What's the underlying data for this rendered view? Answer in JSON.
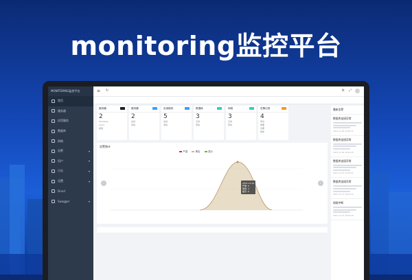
{
  "banner": {
    "title": "monitoring监控平台"
  },
  "app": {
    "brand": "MONITORING监控平台",
    "nav": [
      {
        "label": "首页",
        "arrow": ""
      },
      {
        "label": "服务器",
        "arrow": ""
      },
      {
        "label": "应用服务",
        "arrow": ""
      },
      {
        "label": "数据库",
        "arrow": ""
      },
      {
        "label": "网络",
        "arrow": ""
      },
      {
        "label": "告警",
        "arrow": "▾"
      },
      {
        "label": "用户",
        "arrow": "▾"
      },
      {
        "label": "日志",
        "arrow": "▾"
      },
      {
        "label": "设置",
        "arrow": "▾"
      },
      {
        "label": "Druid",
        "arrow": ""
      },
      {
        "label": "Swagger",
        "arrow": "▾"
      }
    ],
    "cards": [
      {
        "title": "服务器",
        "tag_color": "#1f1f1f",
        "num": "2",
        "lines": [
          "Windows",
          "Linux",
          "其他"
        ]
      },
      {
        "title": "服务器",
        "tag_color": "#3aa1ff",
        "num": "2",
        "lines": [
          "在线",
          "离线"
        ]
      },
      {
        "title": "应用程序",
        "tag_color": "#3aa1ff",
        "num": "5",
        "lines": [
          "在线",
          "离线"
        ]
      },
      {
        "title": "数据库",
        "tag_color": "#36cbcb",
        "num": "3",
        "lines": [
          "正常",
          "离线"
        ]
      },
      {
        "title": "网络",
        "tag_color": "#36cbcb",
        "num": "3",
        "lines": [
          "正常",
          "离线"
        ]
      },
      {
        "title": "告警记录",
        "tag_color": "#f59a23",
        "num": "4",
        "lines": [
          "紧急",
          "重要",
          "次要",
          "警告"
        ]
      }
    ],
    "chart": {
      "title": "告警统计",
      "legend": [
        {
          "name": "严重",
          "color": "#f5222d"
        },
        {
          "name": "警告",
          "color": "#d4b483"
        },
        {
          "name": "提示",
          "color": "#52c41a"
        }
      ],
      "tooltip": [
        "2021-11-24",
        "严重: 0",
        "警告: 4",
        "提示: 0"
      ]
    },
    "right": {
      "header": "最新告警",
      "items": [
        {
          "title": "数据库连接异常",
          "date": "2021-11-06 18:39:31"
        },
        {
          "title": "数据库连接异常",
          "date": "2021-11-06 18:30:45"
        },
        {
          "title": "数据库连接异常",
          "date": "2021-11-07 19:18:21"
        },
        {
          "title": "数据库连接异常",
          "date": "2021-11-07 18:53:24"
        },
        {
          "title": "网络中断",
          "date": "2021-11-07 18:02:39"
        }
      ]
    }
  }
}
